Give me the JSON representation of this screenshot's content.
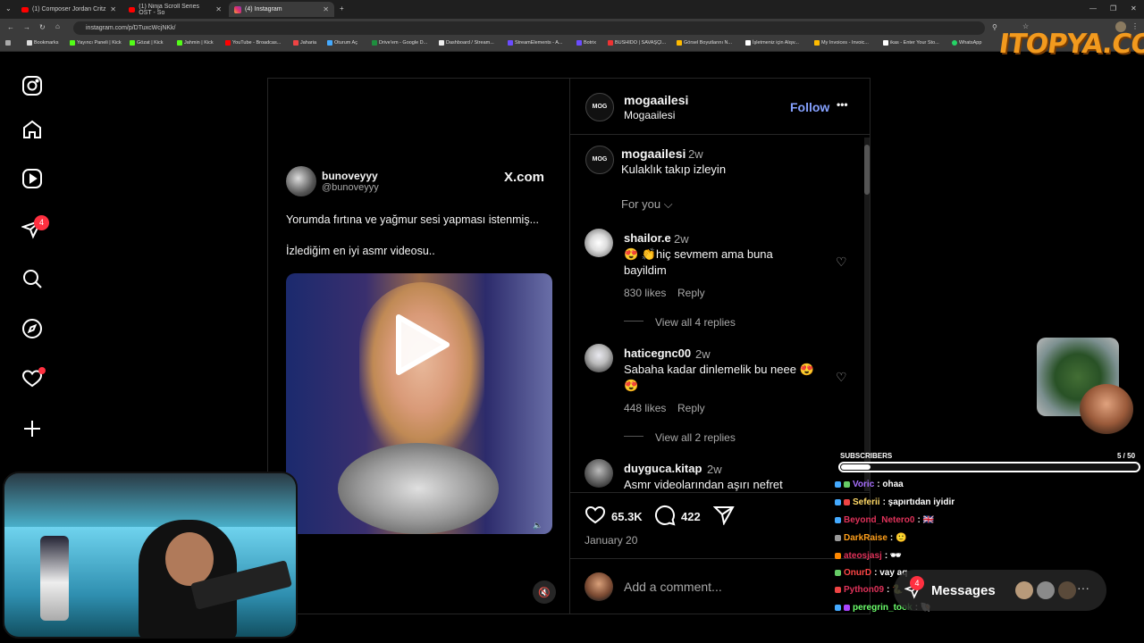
{
  "browser": {
    "tabs": [
      {
        "label": "(1) Composer Jordan Critz",
        "icon": "youtube-icon"
      },
      {
        "label": "(1) Ninja Scroll Series OST - So",
        "icon": "youtube-icon"
      },
      {
        "label": "(4) Instagram",
        "icon": "instagram-icon"
      }
    ],
    "new_tab": "+",
    "url": "instagram.com/p/DTuxcWcjNKk/",
    "bookmarks": [
      "Bookmarks",
      "Yayıncı Paneli | Kick",
      "Gözat | Kick",
      "Jahmin | Kick",
      "YouTube - Broadcas...",
      "Jaharia",
      "Oturum Aç",
      "Drive'em - Google D...",
      "Dashboard / Stream...",
      "StreamElements - A...",
      "Botrix",
      "BUSHIDO | SAVAŞÇI...",
      "Görsel Boyutlarını N...",
      "İşletmeniz için Alışv...",
      "My Invoices - Invoic...",
      "ikas - Enter Your Sto...",
      "WhatsApp"
    ]
  },
  "watermark": "ITOPYA.COM",
  "sidebar": {
    "items": [
      {
        "name": "instagram-logo-icon"
      },
      {
        "name": "home-icon"
      },
      {
        "name": "reels-icon"
      },
      {
        "name": "messages-icon",
        "badge": "4"
      },
      {
        "name": "search-icon"
      },
      {
        "name": "explore-icon"
      },
      {
        "name": "notifications-icon"
      },
      {
        "name": "create-icon"
      }
    ]
  },
  "post": {
    "media": {
      "tweet_name": "bunoveyyy",
      "tweet_handle": "@bunoveyyy",
      "tweet_source": "X.com",
      "tweet_line1": "Yorumda fırtına ve yağmur sesi yapması istenmiş...",
      "tweet_line2": "İzlediğim en iyi asmr videosu.."
    },
    "header": {
      "username": "mogaailesi",
      "subtitle": "Mogaailesi",
      "avatar_text": "MOG",
      "follow": "Follow",
      "more": "•••"
    },
    "caption": {
      "username": "mogaailesi",
      "time": "2w",
      "text": "Kulaklık takıp izleyin"
    },
    "sort_label": "For you",
    "comments": [
      {
        "username": "shailor.e",
        "time": "2w",
        "text1": "😍 👏hiç sevmem ama buna",
        "text2": "bayildim",
        "likes": "830 likes",
        "reply": "Reply",
        "view_replies": "View all 4 replies"
      },
      {
        "username": "haticegnc00",
        "time": "2w",
        "text1": "Sabaha kadar dinlemelik bu neee 😍",
        "text2": "😍",
        "likes": "448 likes",
        "reply": "Reply",
        "view_replies": "View all 2 replies"
      },
      {
        "username": "duyguca.kitap",
        "time": "2w",
        "text1": "Asmr videolarından aşırı nefret"
      }
    ],
    "actions": {
      "like_count": "65.3K",
      "comment_count": "422"
    },
    "date": "January 20",
    "add_comment_placeholder": "Add a comment..."
  },
  "overlay": {
    "subscribers_label": "SUBSCRIBERS",
    "subscribers_count": "5 / 50",
    "subscribers_progress": 0.1,
    "chat": [
      {
        "user": "Voric",
        "msg": ": ohaa",
        "color": "#a970ff"
      },
      {
        "user": "Seferii",
        "msg": ": şapırtıdan iyidir",
        "color": "#ffd966"
      },
      {
        "user": "Beyond_Netero0",
        "msg": ": 🇬🇧",
        "color": "#e0325a"
      },
      {
        "user": "DarkRaise",
        "msg": ": 🙂",
        "color": "#ff9f1a"
      },
      {
        "user": "ateosjasj",
        "msg": ": 🕶",
        "color": "#e0325a"
      },
      {
        "user": "OnurD",
        "msg": ": vay aq",
        "color": "#ff4646"
      },
      {
        "user": "Python09",
        "msg": ": 🐍",
        "color": "#e0325a"
      },
      {
        "user": "peregrin_took",
        "msg": ": 🐚",
        "color": "#6bff6b"
      }
    ]
  },
  "messages_bar": {
    "label": "Messages",
    "badge": "4",
    "more": "···"
  }
}
